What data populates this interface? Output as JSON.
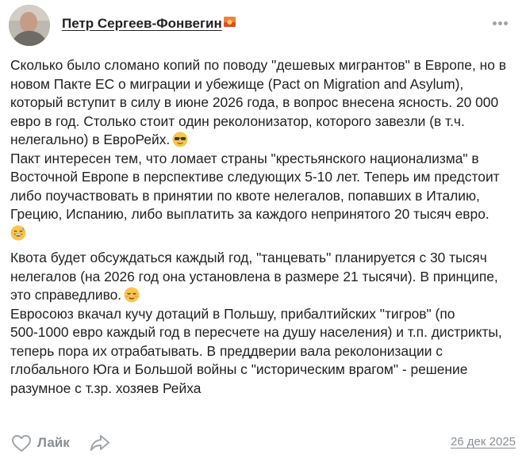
{
  "author": {
    "name": "Петр Сергеев-Фонвегин",
    "flag_icon": "sunset-flag-icon"
  },
  "more_icon": "more-dots-icon",
  "post": {
    "lines": [
      "Сколько было сломано копий по поводу \"дешевых мигрантов\" в Европе, но в",
      "новом Пакте ЕС о миграции и убежище (Pact on Migration and Asylum),",
      "который вступит в силу в июне 2026 года, в вопрос внесена ясность. 20 000",
      "евро в год. Столько стоит один реколонизатор, которого завезли (в т.ч.",
      "нелегально) в ЕвроРейх.",
      "Пакт интересен тем, что ломает страны \"крестьянского национализма\" в",
      "Восточной Европе в перспективе следующих 5-10 лет. Теперь им предстоит",
      "либо поучаствовать в принятии по квоте нелегалов, попавших в Италию,",
      "Грецию, Испанию, либо выплатить за каждого непринятого 20 тысяч евро.",
      "",
      "Квота будет обсуждаться каждый год, \"танцевать\" планируется с 30 тысяч",
      "нелегалов (на 2026 год она установлена в размере 21 тысячи). В принципе,",
      "это справедливо.",
      "Евросоюз вкачал кучу дотаций в Польшу, прибалтийских \"тигров\" (по",
      "500-1000 евро каждый год в пересчете на душу населения) и т.п. дистрикты,",
      "теперь пора их отрабатывать. В преддверии вала реколонизации с",
      "глобального Юга и Большой войны с \"историческим врагом\" - решение",
      "разумное с т.зр. хозяев Рейха"
    ],
    "emojis": [
      "sunglasses-emoji",
      "grinning-sweat-emoji",
      "relieved-emoji"
    ]
  },
  "footer": {
    "like_label": "Лайк",
    "like_icon": "heart-outline-icon",
    "share_icon": "share-arrow-icon",
    "date": "26 дек 2025"
  },
  "colors": {
    "text": "#222222",
    "muted": "#8a8f96",
    "icon": "#a0a4aa"
  }
}
